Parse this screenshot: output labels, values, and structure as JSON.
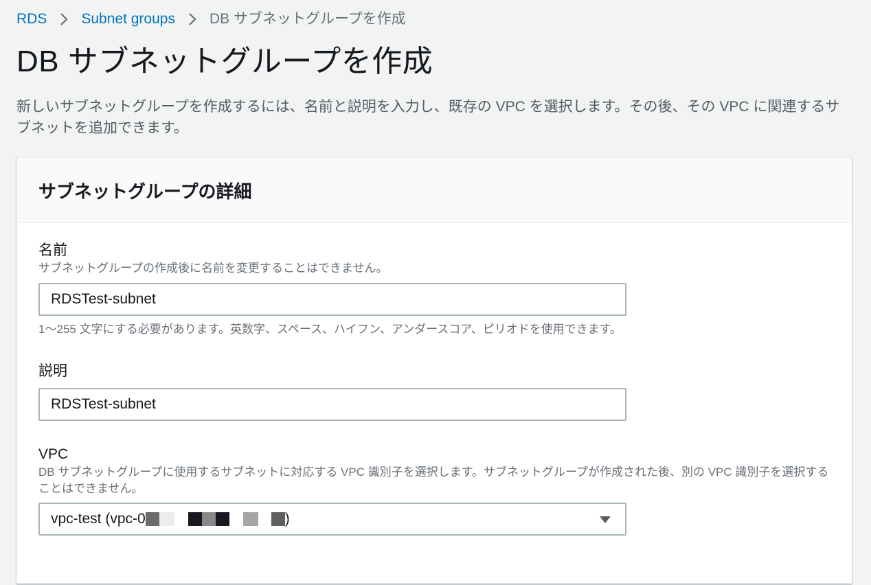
{
  "breadcrumb": {
    "items": [
      {
        "label": "RDS"
      },
      {
        "label": "Subnet groups"
      }
    ],
    "current": "DB サブネットグループを作成"
  },
  "page": {
    "title": "DB サブネットグループを作成",
    "description": "新しいサブネットグループを作成するには、名前と説明を入力し、既存の VPC を選択します。その後、その VPC に関連するサブネットを追加できます。"
  },
  "panel": {
    "title": "サブネットグループの詳細",
    "name_field": {
      "label": "名前",
      "description": "サブネットグループの作成後に名前を変更することはできません。",
      "value": "RDSTest-subnet",
      "constraint": "1〜255 文字にする必要があります。英数字、スペース、ハイフン、アンダースコア、ピリオドを使用できます。"
    },
    "description_field": {
      "label": "説明",
      "value": "RDSTest-subnet"
    },
    "vpc_field": {
      "label": "VPC",
      "description": "DB サブネットグループに使用するサブネットに対応する VPC 識別子を選択します。サブネットグループが作成された後、別の VPC 識別子を選択することはできません。",
      "selected_prefix": "vpc-test (vpc-0",
      "selected_suffix": ")"
    }
  },
  "colors": {
    "link": "#0073bb",
    "background": "#f2f3f3",
    "border": "#aab7b8",
    "text": "#16191f",
    "secondary_text": "#687078"
  }
}
